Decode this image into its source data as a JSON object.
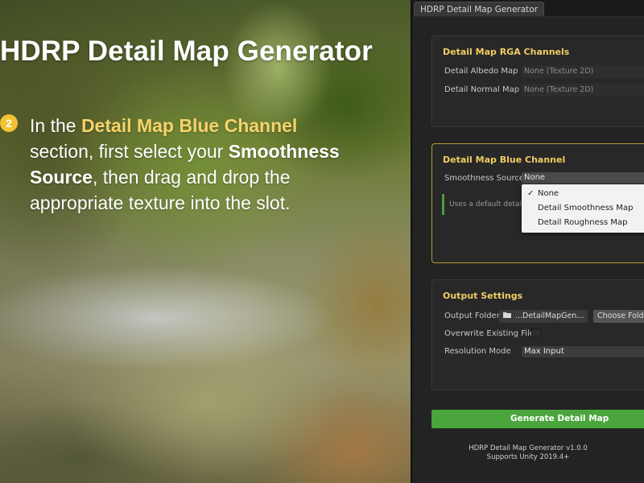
{
  "slide": {
    "headline": "HDRP Detail Map Generator",
    "step_number": "2",
    "step_text": {
      "part1": "In the ",
      "highlight": "Detail Map Blue Channel",
      "part2": " section, first select your ",
      "bold": "Smoothness Source",
      "part3": ", then drag and drop the appropriate texture into the slot."
    },
    "accent_color": "#f6d36a",
    "badge_color": "#f2c230"
  },
  "editor": {
    "tab_title": "HDRP Detail Map Generator",
    "rga_section": {
      "title": "Detail Map RGA Channels",
      "albedo_label": "Detail Albedo Map",
      "albedo_value": "None (Texture 2D)",
      "normal_label": "Detail Normal Map",
      "normal_value": "None (Texture 2D)"
    },
    "blue_section": {
      "title": "Detail Map Blue Channel",
      "smoothness_label": "Smoothness Source",
      "smoothness_value": "None",
      "help_text": "Uses a default detail s",
      "menu_options": [
        "None",
        "Detail Smoothness Map",
        "Detail Roughness Map"
      ],
      "menu_checkmark": "✓"
    },
    "output_section": {
      "title": "Output Settings",
      "folder_label": "Output Folder",
      "folder_value": "...DetailMapGen...",
      "choose_folder_label": "Choose Folder",
      "overwrite_label": "Overwrite Existing Files",
      "resolution_label": "Resolution Mode",
      "resolution_value": "Max Input"
    },
    "generate_label": "Generate Detail Map",
    "footer_line1": "HDRP Detail Map Generator v1.0.0",
    "footer_line2": "Supports Unity 2019.4+",
    "accent_color": "#f0cd62",
    "generate_color": "#4aa53c"
  }
}
